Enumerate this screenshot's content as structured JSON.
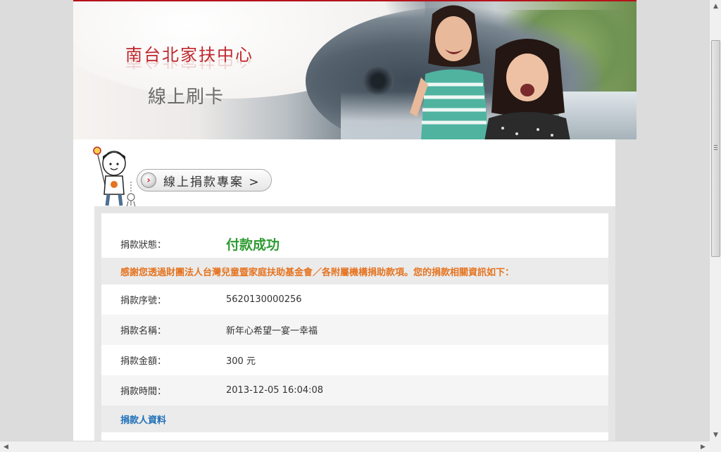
{
  "banner": {
    "org_name": "南台北家扶中心",
    "subtitle": "線上刷卡"
  },
  "campaign_button": {
    "label": "線上捐款專案 >",
    "arrow_glyph": "›"
  },
  "donation": {
    "status_label": "捐款狀態：",
    "status_value": "付款成功",
    "thanks_message": "感謝您透過財團法人台灣兒童暨家庭扶助基金會／各附屬機構捐助款項。您的捐款相關資訊如下：",
    "serial_label": "捐款序號：",
    "serial_value": "5620130000256",
    "name_label": "捐款名稱：",
    "name_value": "新年心希望一宴一幸福",
    "amount_label": "捐款金額：",
    "amount_value": "300 元",
    "time_label": "捐款時間：",
    "time_value": "2013-12-05 16:04:08",
    "donor_section_title": "捐款人資料"
  },
  "colors": {
    "status_success": "#2e9b32",
    "thanks_orange": "#e5731f",
    "section_blue": "#1f6fb8",
    "brand_red": "#c0272d"
  },
  "icons": {
    "campaign_arrow": "chevron-right-icon",
    "mascot": "mascot-illustration",
    "scroll_up": "arrow-up-icon",
    "scroll_down": "arrow-down-icon",
    "scroll_left": "arrow-left-icon",
    "scroll_right": "arrow-right-icon"
  }
}
